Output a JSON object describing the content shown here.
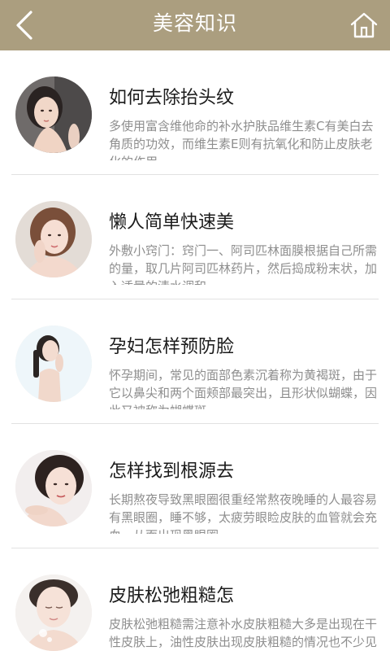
{
  "header": {
    "title": "美容知识",
    "back_icon": "chevron-left-icon",
    "home_icon": "home-icon",
    "bar_color": "#ab9e7f"
  },
  "articles": [
    {
      "title": "如何去除抬头纹",
      "summary": "多使用富含维他命的补水护肤品维生素C有美白去角质的功效，而维生素E则有抗氧化和防止皮肤老化的作用"
    },
    {
      "title": "懒人简单快速美",
      "summary": "外敷小窍门：窍门一、阿司匹林面膜根据自己所需的量，取几片阿司匹林药片，然后捣成粉末状，加入适量的清水调和"
    },
    {
      "title": "孕妇怎样预防脸",
      "summary": "怀孕期间，常见的面部色素沉着称为黄褐斑，由于它以鼻尖和两个面颊部最突出，且形状似蝴蝶，因此又被称为蝴蝶斑"
    },
    {
      "title": "怎样找到根源去",
      "summary": "长期熬夜导致黑眼圈很重经常熬夜晚睡的人最容易有黑眼圈，睡不够，太疲劳眼睑皮肤的血管就会充血，从而出现黑眼圈"
    },
    {
      "title": "皮肤松弛粗糙怎",
      "summary": "皮肤松弛粗糙需注意补水皮肤粗糙大多是出现在干性皮肤上，油性皮肤出现皮肤粗糙的情况也不少见"
    }
  ]
}
